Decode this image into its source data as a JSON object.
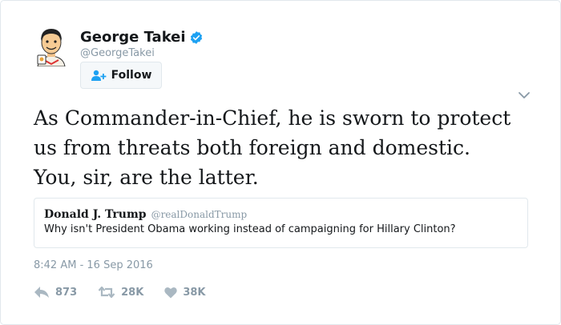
{
  "user": {
    "display_name": "George Takei",
    "handle": "@GeorgeTakei",
    "avatar_icon": "cartoon-avatar",
    "verified": true
  },
  "follow_button": {
    "label": "Follow",
    "icon": "add-user-icon"
  },
  "tweet": {
    "text": "As Commander-in-Chief, he is sworn to protect us from threats both foreign and domestic. You, sir, are the latter.",
    "timestamp": "8:42 AM - 16 Sep 2016"
  },
  "quoted_tweet": {
    "display_name": "Donald J. Trump",
    "handle": "@realDonaldTrump",
    "text": "Why isn't President Obama working instead of campaigning for Hillary Clinton?"
  },
  "actions": {
    "reply_count": "873",
    "retweet_count": "28K",
    "like_count": "38K"
  },
  "colors": {
    "accent": "#1da1f2",
    "muted": "#8899a6",
    "border": "#e1e8ed",
    "text": "#14171a"
  }
}
